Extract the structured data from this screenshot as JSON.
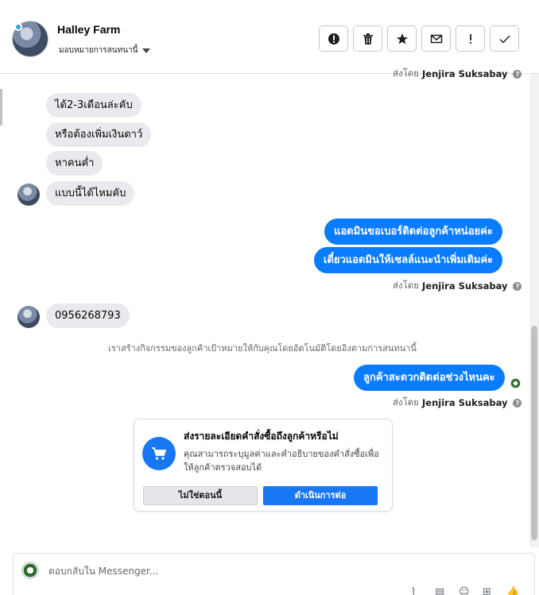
{
  "header": {
    "page_name": "Halley Farm",
    "assign_label": "มอบหมายการสนทนานี้"
  },
  "toolbar": {
    "spam_icon": "alert-circle-icon",
    "delete_icon": "trash-icon",
    "star_icon": "star-icon",
    "unread_icon": "envelope-icon",
    "followup_icon": "exclamation-icon",
    "done_icon": "check-icon"
  },
  "messages": {
    "top_sent_by": "ส่งโดย",
    "top_sender": "Jenjira Suksabay",
    "incoming_1": [
      "ได้2-3เดือนล่ะคับ",
      "หรือต้องเพิ่มเงินดาว์",
      "หาคนค่ำ",
      "แบบนี้ได้ไหมคับ"
    ],
    "outgoing_1": [
      "แอดมินขอเบอร์ติดต่อลูกค้าหน่อยค่ะ",
      "เดี๋ยวแอดมินให้เซลล์แนะนำเพิ่มเติมค่ะ"
    ],
    "sent_by_1": "ส่งโดย",
    "sender_1": "Jenjira Suksabay",
    "incoming_2": "0956268793",
    "system_note": "เราสร้างกิจกรรมของลูกค้าเป้าหมายให้กับคุณโดยอัตโนมัติโดยอิงตามการสนทนานี้",
    "outgoing_2": "ลูกค้าสะดวกติดต่อช่วงไหนคะ",
    "sent_by_2": "ส่งโดย",
    "sender_2": "Jenjira Suksabay"
  },
  "order_card": {
    "title": "ส่งรายละเอียดคำสั่งซื้อถึงลูกค้าหรือไม่",
    "description": "คุณสามารถระบุมูลค่าและคำอธิบายของคำสั่งซื้อเพื่อให้ลูกค้าตรวจสอบได้",
    "decline_label": "ไม่ใช่ตอนนี้",
    "accept_label": "ดำเนินการต่อ"
  },
  "composer": {
    "placeholder": "ตอบกลับใน Messenger..."
  },
  "colors": {
    "accent": "#0a7cff",
    "incoming_bubble": "#e9eaed"
  }
}
